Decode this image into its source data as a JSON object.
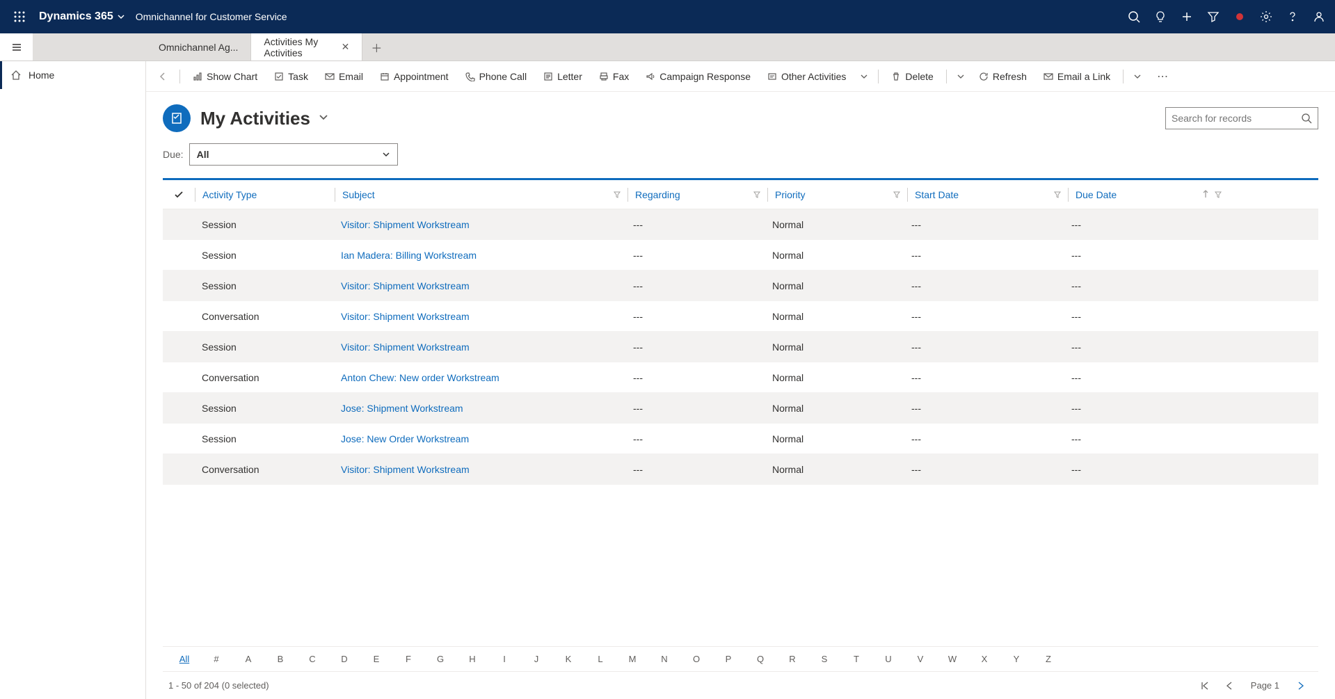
{
  "header": {
    "brand": "Dynamics 365",
    "app": "Omnichannel for Customer Service"
  },
  "tabs": {
    "inactive": "Omnichannel Ag...",
    "active": "Activities My Activities"
  },
  "sidebar": {
    "home": "Home"
  },
  "commands": {
    "show_chart": "Show Chart",
    "task": "Task",
    "email": "Email",
    "appointment": "Appointment",
    "phone_call": "Phone Call",
    "letter": "Letter",
    "fax": "Fax",
    "campaign_response": "Campaign Response",
    "other_activities": "Other Activities",
    "delete": "Delete",
    "refresh": "Refresh",
    "email_link": "Email a Link"
  },
  "page": {
    "title": "My Activities",
    "search_placeholder": "Search for records",
    "due_label": "Due:",
    "due_value": "All"
  },
  "columns": {
    "activity_type": "Activity Type",
    "subject": "Subject",
    "regarding": "Regarding",
    "priority": "Priority",
    "start_date": "Start Date",
    "due_date": "Due Date"
  },
  "rows": [
    {
      "type": "Session",
      "subject": "Visitor: Shipment Workstream",
      "regarding": "---",
      "priority": "Normal",
      "start": "---",
      "due": "---"
    },
    {
      "type": "Session",
      "subject": "Ian Madera: Billing Workstream",
      "regarding": "---",
      "priority": "Normal",
      "start": "---",
      "due": "---"
    },
    {
      "type": "Session",
      "subject": "Visitor: Shipment Workstream",
      "regarding": "---",
      "priority": "Normal",
      "start": "---",
      "due": "---"
    },
    {
      "type": "Conversation",
      "subject": "Visitor: Shipment Workstream",
      "regarding": "---",
      "priority": "Normal",
      "start": "---",
      "due": "---"
    },
    {
      "type": "Session",
      "subject": "Visitor: Shipment Workstream",
      "regarding": "---",
      "priority": "Normal",
      "start": "---",
      "due": "---"
    },
    {
      "type": "Conversation",
      "subject": "Anton Chew: New order Workstream",
      "regarding": "---",
      "priority": "Normal",
      "start": "---",
      "due": "---"
    },
    {
      "type": "Session",
      "subject": "Jose: Shipment Workstream",
      "regarding": "---",
      "priority": "Normal",
      "start": "---",
      "due": "---"
    },
    {
      "type": "Session",
      "subject": "Jose: New Order Workstream",
      "regarding": "---",
      "priority": "Normal",
      "start": "---",
      "due": "---"
    },
    {
      "type": "Conversation",
      "subject": "Visitor: Shipment Workstream",
      "regarding": "---",
      "priority": "Normal",
      "start": "---",
      "due": "---"
    }
  ],
  "alpha": [
    "All",
    "#",
    "A",
    "B",
    "C",
    "D",
    "E",
    "F",
    "G",
    "H",
    "I",
    "J",
    "K",
    "L",
    "M",
    "N",
    "O",
    "P",
    "Q",
    "R",
    "S",
    "T",
    "U",
    "V",
    "W",
    "X",
    "Y",
    "Z"
  ],
  "footer": {
    "count": "1 - 50 of 204 (0 selected)",
    "page": "Page 1"
  }
}
